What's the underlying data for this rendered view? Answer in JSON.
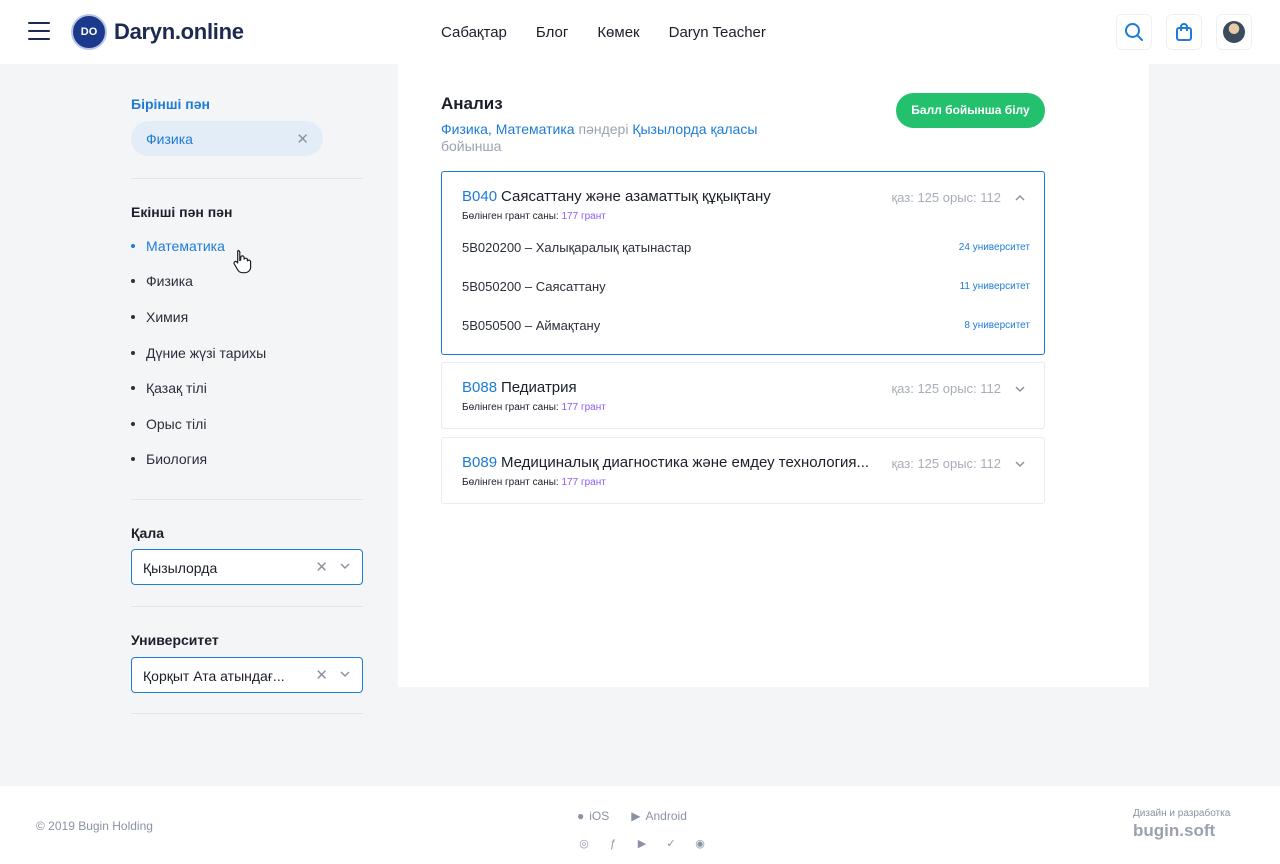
{
  "header": {
    "logo_badge": "DO",
    "logo_text": "Daryn.online",
    "nav": [
      "Сабақтар",
      "Блог",
      "Көмек",
      "Daryn Teacher"
    ]
  },
  "sidebar": {
    "first_subject": {
      "title": "Бірінші пән",
      "chip": "Физика"
    },
    "second_subject": {
      "title": "Екінші пән пән",
      "items": [
        "Математика",
        "Физика",
        "Химия",
        "Дүние жүзі тарихы",
        "Қазақ тілі",
        "Орыс тілі",
        "Биология"
      ],
      "active_item": "Математика"
    },
    "city": {
      "title": "Қала",
      "value": "Қызылорда"
    },
    "university": {
      "title": "Университет",
      "value": "Қорқыт Ата атындағ..."
    }
  },
  "main": {
    "title": "Анализ",
    "subtitle": {
      "subjects": "Физика, Математика",
      "mid": " пәндері ",
      "city": "Қызылорда қаласы",
      "tail": " бойынша"
    },
    "score_button": "Балл бойынша білу",
    "accordion": [
      {
        "code": "B040",
        "name": "Саясаттану және азаматтық құқықтану",
        "score": "қаз: 125 орыс: 112",
        "grant_label": "Бөлінген грант саны:",
        "grant_value": "177 грант",
        "open": true,
        "rows": [
          {
            "spec": "5B020200 – Халықаралық қатынастар",
            "uni": "24 университет"
          },
          {
            "spec": "5B050200 – Саясаттану",
            "uni": "11 университет"
          },
          {
            "spec": "5B050500 – Аймақтану",
            "uni": "8 университет"
          }
        ]
      },
      {
        "code": "B088",
        "name": "Педиатрия",
        "score": "қаз: 125 орыс: 112",
        "grant_label": "Бөлінген грант саны:",
        "grant_value": "177 грант",
        "open": false
      },
      {
        "code": "B089",
        "name": "Медициналық диагностика және емдеу технология...",
        "score": "қаз: 125 орыс: 112",
        "grant_label": "Бөлінген грант саны:",
        "grant_value": "177 грант",
        "open": false
      }
    ]
  },
  "footer": {
    "copyright": "© 2019 Bugin Holding",
    "ios": "iOS",
    "android": "Android",
    "made_by": "Дизайн и разработка",
    "brand": "bugin.soft"
  },
  "colors": {
    "accent": "#1e7bd8",
    "green": "#23c06e",
    "purple": "#8b5cf6"
  }
}
